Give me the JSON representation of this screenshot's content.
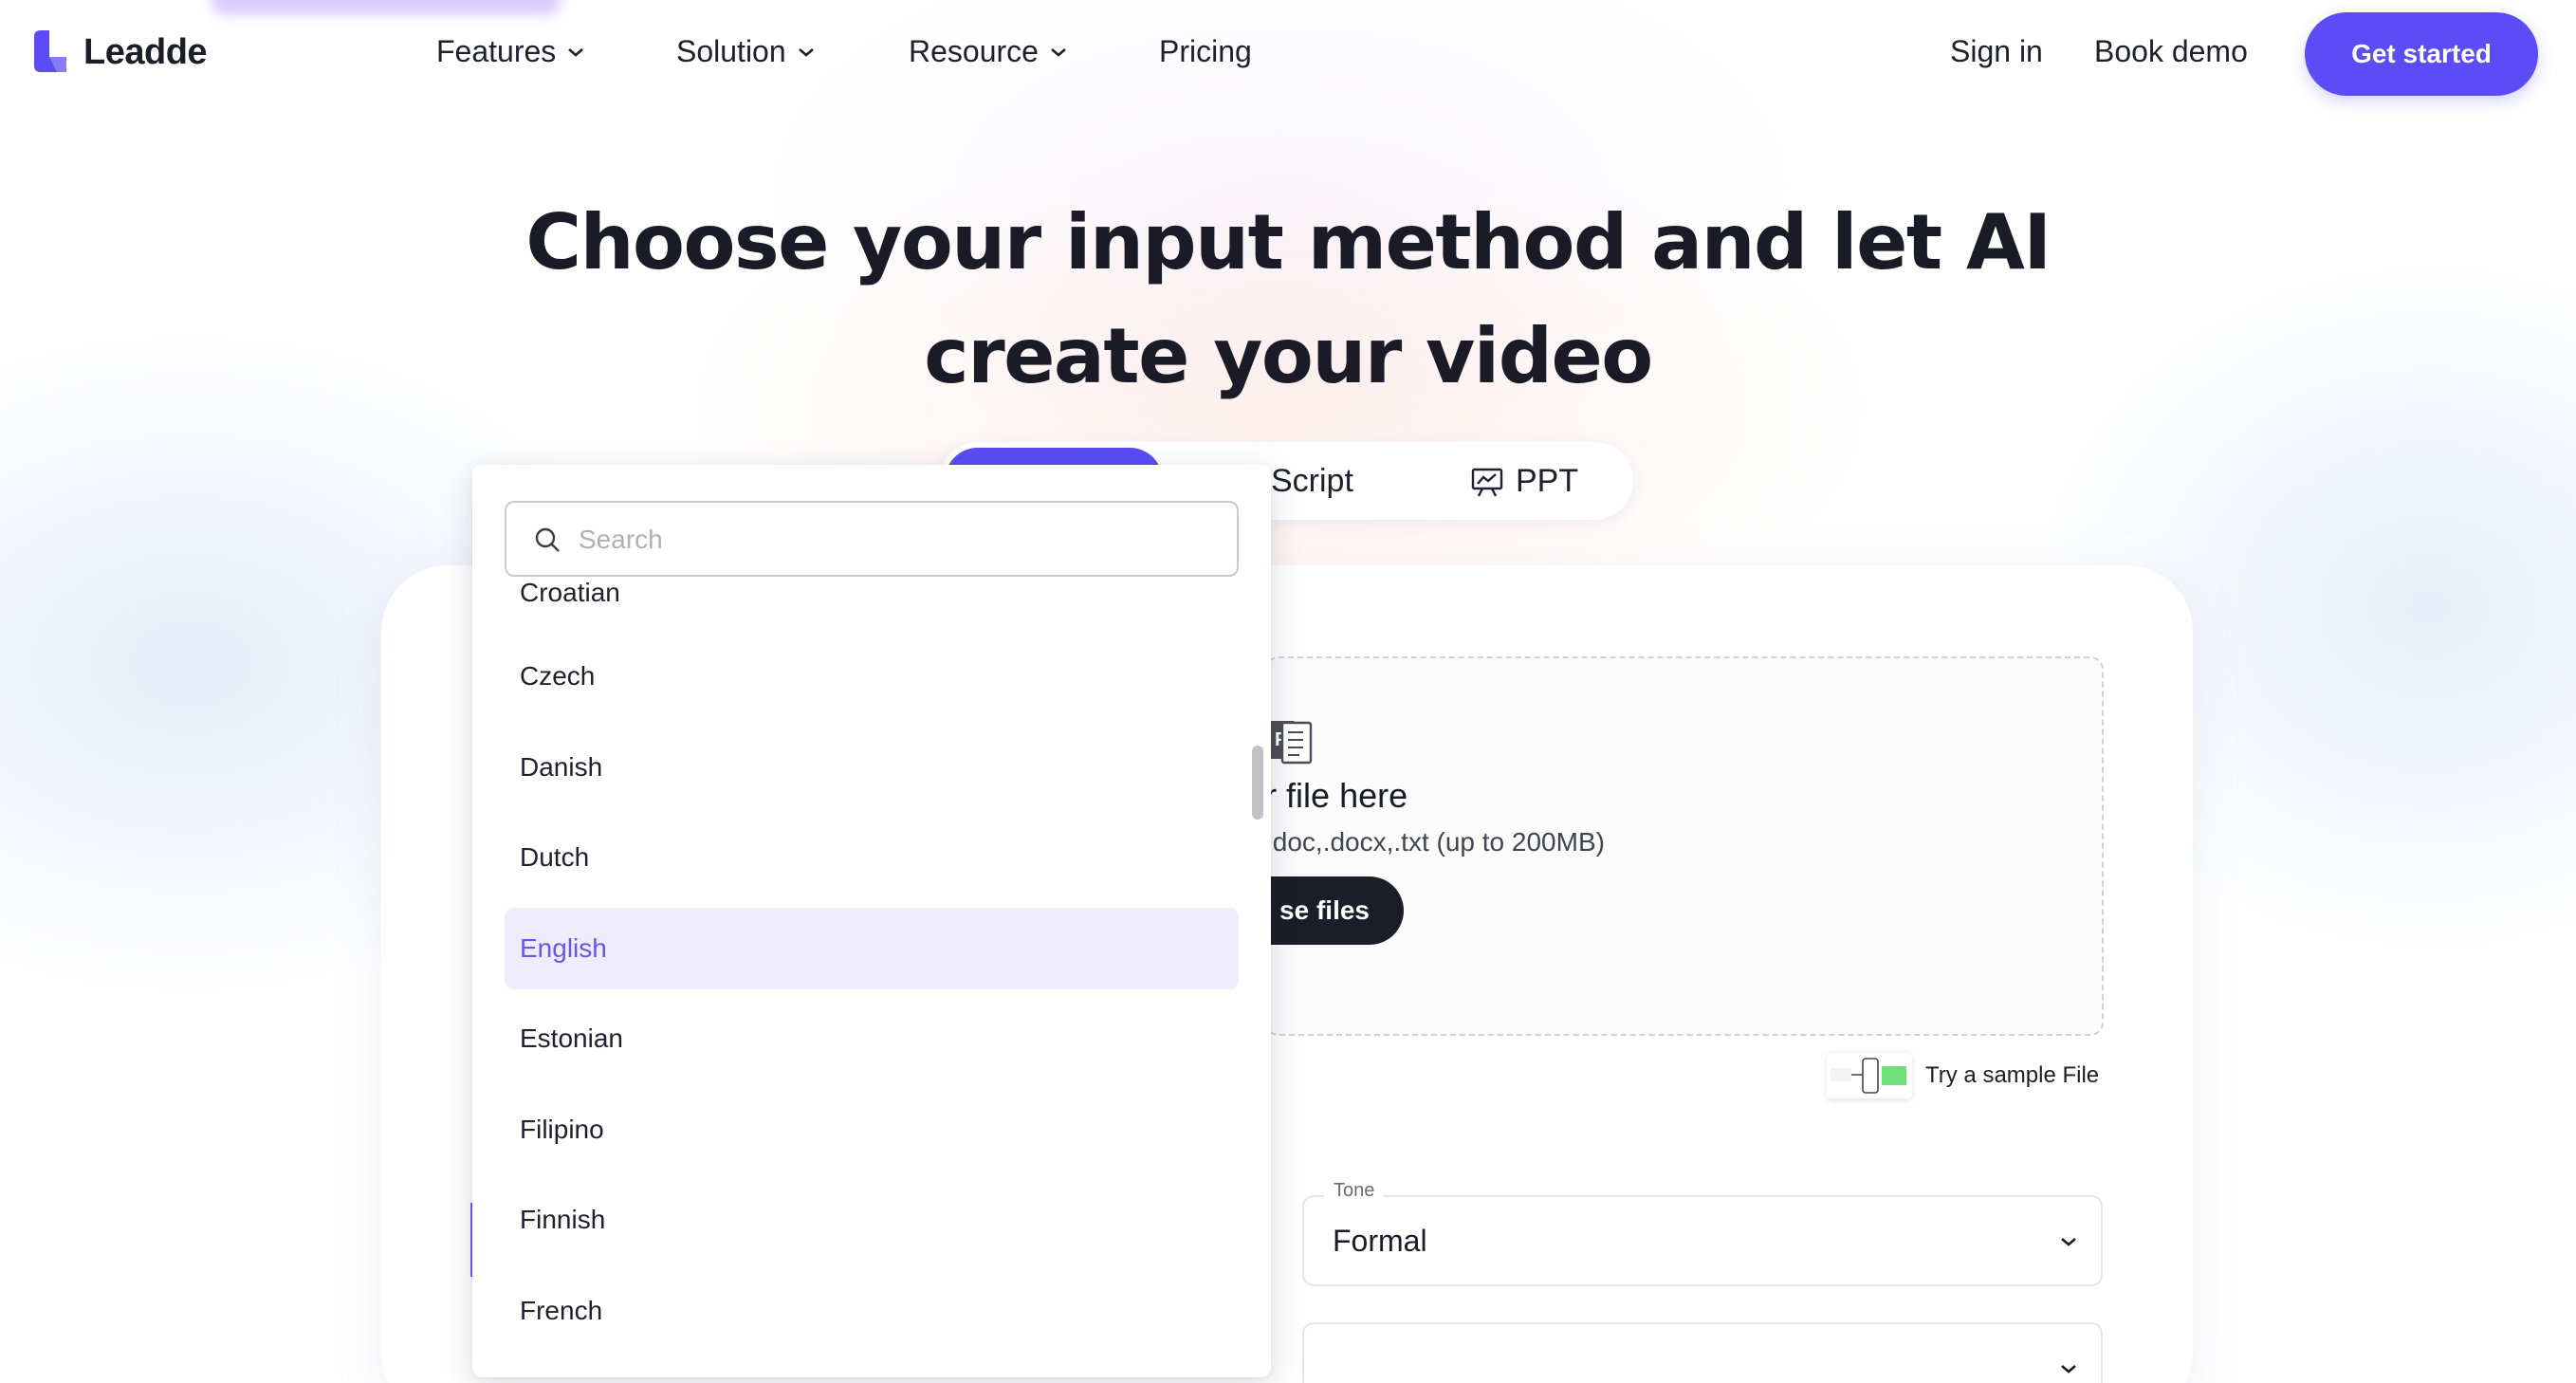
{
  "nav": {
    "logo_text": "Leadde",
    "menu": [
      {
        "label": "Features"
      },
      {
        "label": "Solution"
      },
      {
        "label": "Resource"
      }
    ],
    "pricing": "Pricing",
    "sign_in": "Sign in",
    "book_demo": "Book demo",
    "get_started": "Get started"
  },
  "hero": {
    "title_line1": "Choose your input method and let AI",
    "title_line2": "create your video"
  },
  "tabs": {
    "script": "Script",
    "ppt": "PPT"
  },
  "upload": {
    "title": "p your file here",
    "subtitle": ".doc,.docx,.txt (up to 200MB)",
    "choose_button": "se files",
    "sample_link": "Try a sample File"
  },
  "settings": {
    "tone_label": "Tone",
    "tone_value": "Formal"
  },
  "language_dropdown": {
    "search_placeholder": "Search",
    "options": [
      "Croatian",
      "Czech",
      "Danish",
      "Dutch",
      "English",
      "Estonian",
      "Filipino",
      "Finnish",
      "French"
    ],
    "selected": "English"
  },
  "colors": {
    "accent": "#5b4cf5",
    "selected_bg": "#efecfe",
    "selected_text": "#6a55e8",
    "dark_button": "#1d1d29"
  }
}
